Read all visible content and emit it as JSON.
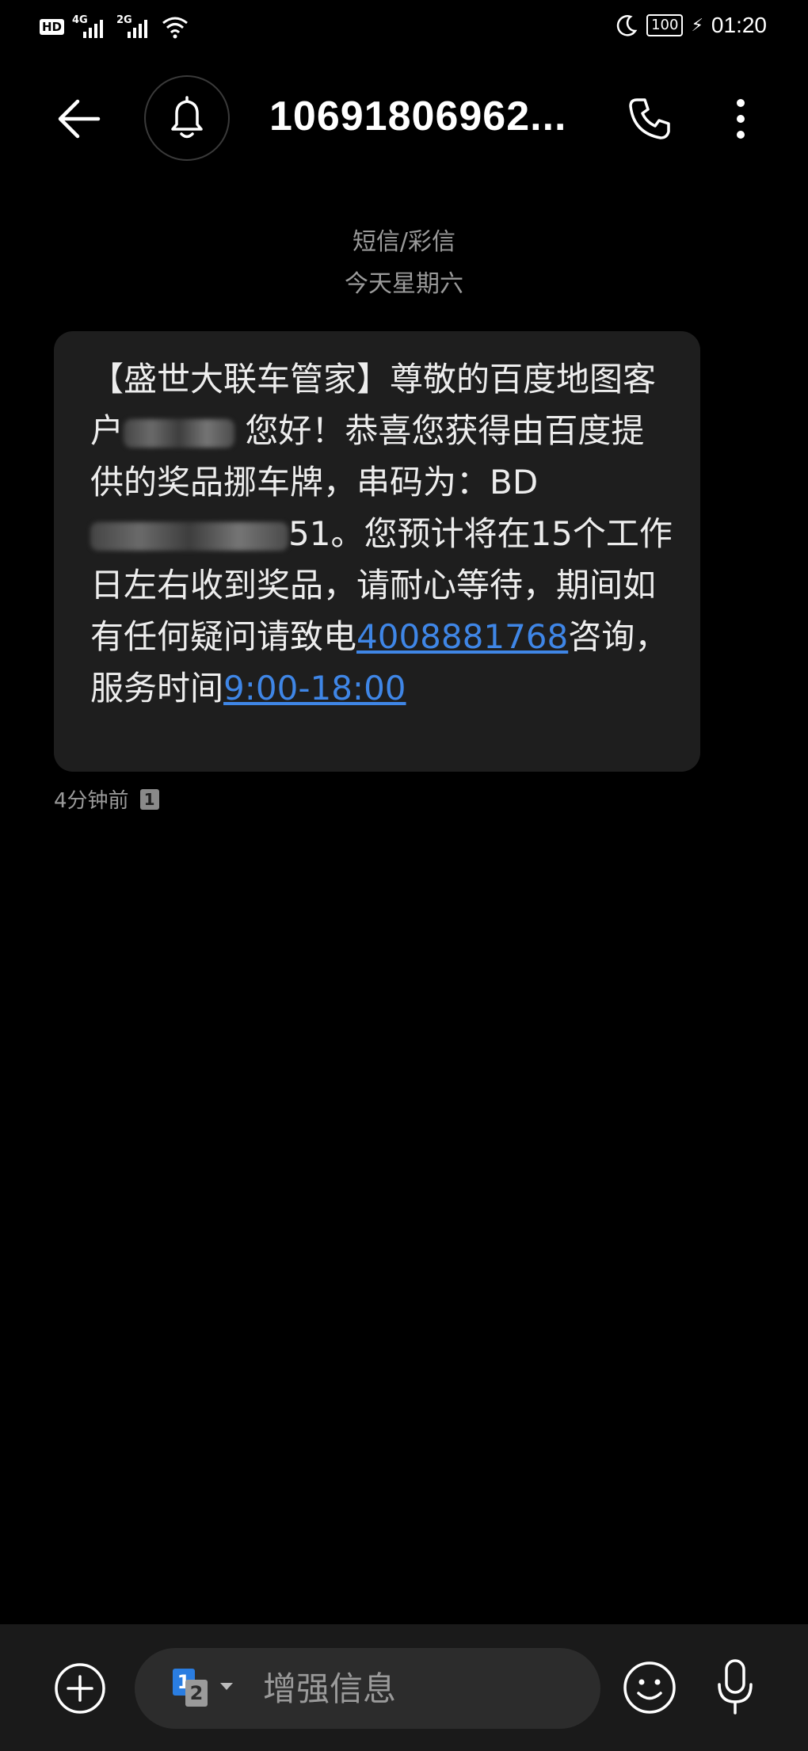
{
  "status_bar": {
    "hd": "HD",
    "sim1_network": "4G",
    "sim2_network": "2G",
    "battery": "100",
    "time": "01:20",
    "icons": [
      "hd-icon",
      "signal-icon",
      "signal-icon",
      "wifi-icon",
      "moon-icon",
      "battery-icon",
      "charging-icon"
    ]
  },
  "header": {
    "title": "10691806962...",
    "icons": [
      "back-arrow-icon",
      "bell-icon",
      "phone-icon",
      "more-vert-icon"
    ]
  },
  "conversation": {
    "channel": "短信/彩信",
    "date": "今天星期六"
  },
  "message": {
    "part1": "【盛世大联车管家】尊敬的百度地图客户",
    "part2": "您好！恭喜您获得由百度提供的奖品挪车牌，串码为：BD",
    "part3": "51。您预计将在15个工作日左右收到奖品，请耐心等待，期间如有任何疑问请致电",
    "phone": "4008881768",
    "part4": "咨询，服务时间",
    "hours": "9:00-18:00",
    "time": "4分钟前",
    "sim": "1"
  },
  "composer": {
    "sim_primary": "1",
    "sim_secondary": "2",
    "placeholder": "增强信息",
    "icons": [
      "plus-icon",
      "emoji-icon",
      "mic-icon"
    ]
  },
  "colors": {
    "background": "#000000",
    "bubble": "#1e1e1e",
    "link": "#3f86e6",
    "secondary_text": "#9a9a9a",
    "sim_blue": "#2a7de1"
  }
}
